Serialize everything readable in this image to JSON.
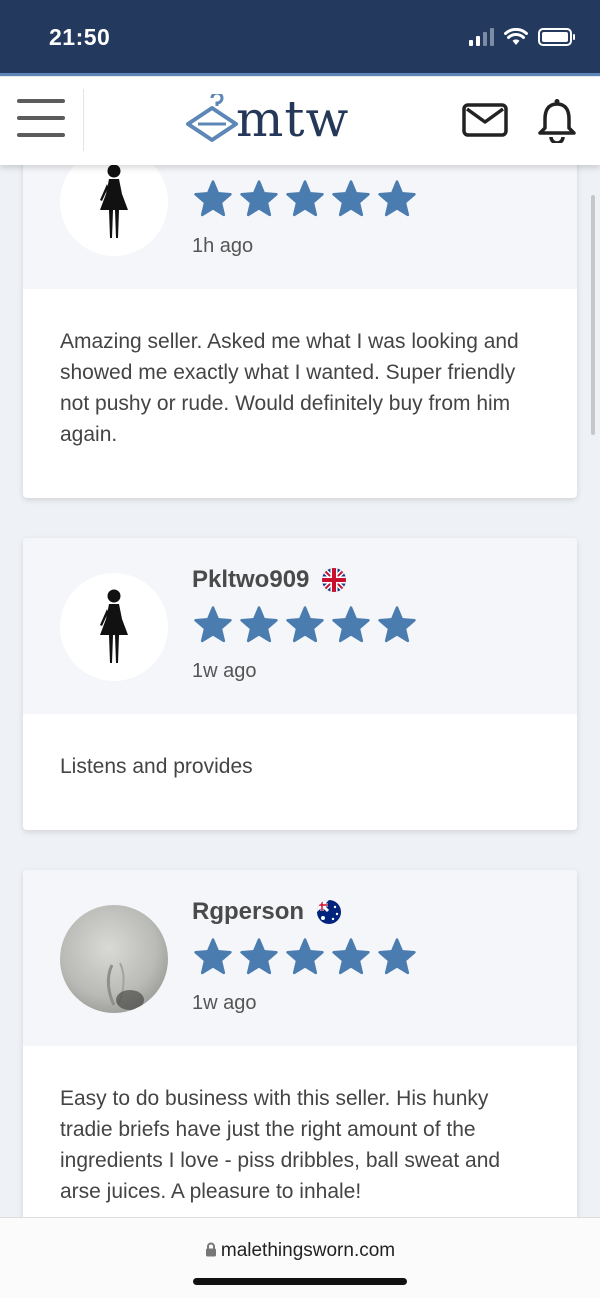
{
  "status_bar": {
    "time": "21:50"
  },
  "header": {
    "logo_text": "mtw",
    "menu_icon": "hamburger-icon",
    "mail_icon": "envelope-icon",
    "bell_icon": "bell-icon"
  },
  "colors": {
    "star": "#4a7cb0",
    "header_bg": "#233a5e",
    "logo": "#26385a"
  },
  "reviews": [
    {
      "username": "",
      "flag": "",
      "rating": 5,
      "time": "1h ago",
      "avatar": "female-silhouette-icon",
      "text": "Amazing seller. Asked me what I was looking and showed me exactly what I wanted. Super friendly not pushy or rude. Would definitely buy from him again."
    },
    {
      "username": "Pkltwo909",
      "flag": "uk-flag-icon",
      "rating": 5,
      "time": "1w ago",
      "avatar": "female-silhouette-icon",
      "text": "Listens and provides"
    },
    {
      "username": "Rgperson",
      "flag": "australia-flag-icon",
      "rating": 5,
      "time": "1w ago",
      "avatar": "photo-avatar",
      "text": "Easy to do business with this seller. His hunky tradie briefs have just the right amount of the ingredients I love - piss dribbles, ball sweat and arse juices. A pleasure to inhale!"
    }
  ],
  "browser": {
    "url": "malethingsworn.com"
  }
}
